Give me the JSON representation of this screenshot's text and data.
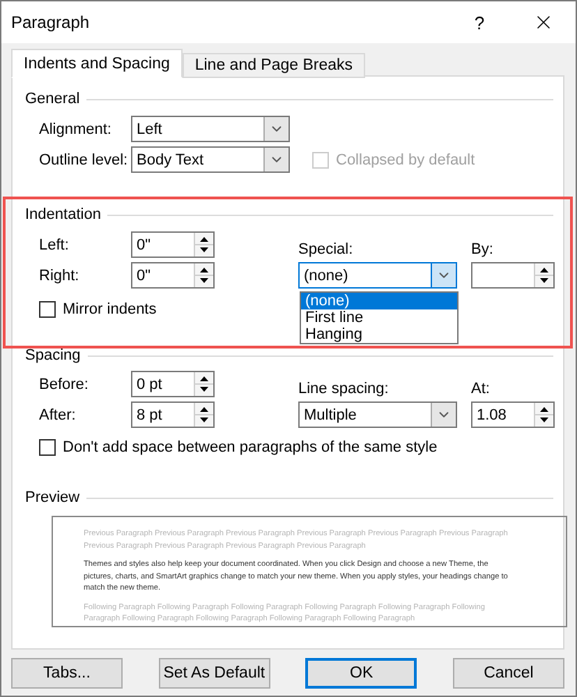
{
  "window": {
    "title": "Paragraph",
    "help": "?"
  },
  "tabs": [
    {
      "label": "Indents and Spacing",
      "selected": true
    },
    {
      "label": "Line and Page Breaks",
      "selected": false
    }
  ],
  "general": {
    "heading": "General",
    "alignment": {
      "label": "Alignment:",
      "value": "Left"
    },
    "outline_level": {
      "label": "Outline level:",
      "value": "Body Text"
    },
    "collapsed": {
      "label": "Collapsed by default",
      "checked": false,
      "disabled": true
    }
  },
  "indentation": {
    "heading": "Indentation",
    "highlighted": true,
    "left": {
      "label": "Left:",
      "value": "0\""
    },
    "right": {
      "label": "Right:",
      "value": "0\""
    },
    "special": {
      "label": "Special:",
      "value": "(none)",
      "expanded": true,
      "options": [
        {
          "label": "(none)",
          "selected": true
        },
        {
          "label": "First line",
          "selected": false
        },
        {
          "label": "Hanging",
          "selected": false
        }
      ]
    },
    "by": {
      "label": "By:"
    },
    "mirror": {
      "label": "Mirror indents",
      "checked": false
    }
  },
  "spacing": {
    "heading": "Spacing",
    "before": {
      "label": "Before:",
      "value": "0 pt"
    },
    "after": {
      "label": "After:",
      "value": "8 pt"
    },
    "line_spacing": {
      "label": "Line spacing:",
      "value": "Multiple"
    },
    "at": {
      "label": "At:",
      "value": "1.08"
    },
    "no_space": {
      "label": "Don't add space between paragraphs of the same style",
      "checked": false
    }
  },
  "preview": {
    "heading": "Preview",
    "previous": "Previous Paragraph Previous Paragraph Previous Paragraph Previous Paragraph Previous Paragraph Previous Paragraph Previous Paragraph Previous Paragraph Previous Paragraph Previous Paragraph",
    "current": "Themes and styles also help keep your document coordinated. When you click Design and choose a new Theme, the pictures, charts, and SmartArt graphics change to match your new theme. When you apply styles, your headings change to match the new theme.",
    "following": "Following Paragraph Following Paragraph Following Paragraph Following Paragraph Following Paragraph Following Paragraph Following Paragraph Following Paragraph Following Paragraph Following Paragraph"
  },
  "buttons": [
    {
      "label": "Tabs...",
      "default": false
    },
    {
      "label": "Set As Default",
      "default": false
    },
    {
      "label": "OK",
      "default": true
    },
    {
      "label": "Cancel",
      "default": false
    }
  ]
}
